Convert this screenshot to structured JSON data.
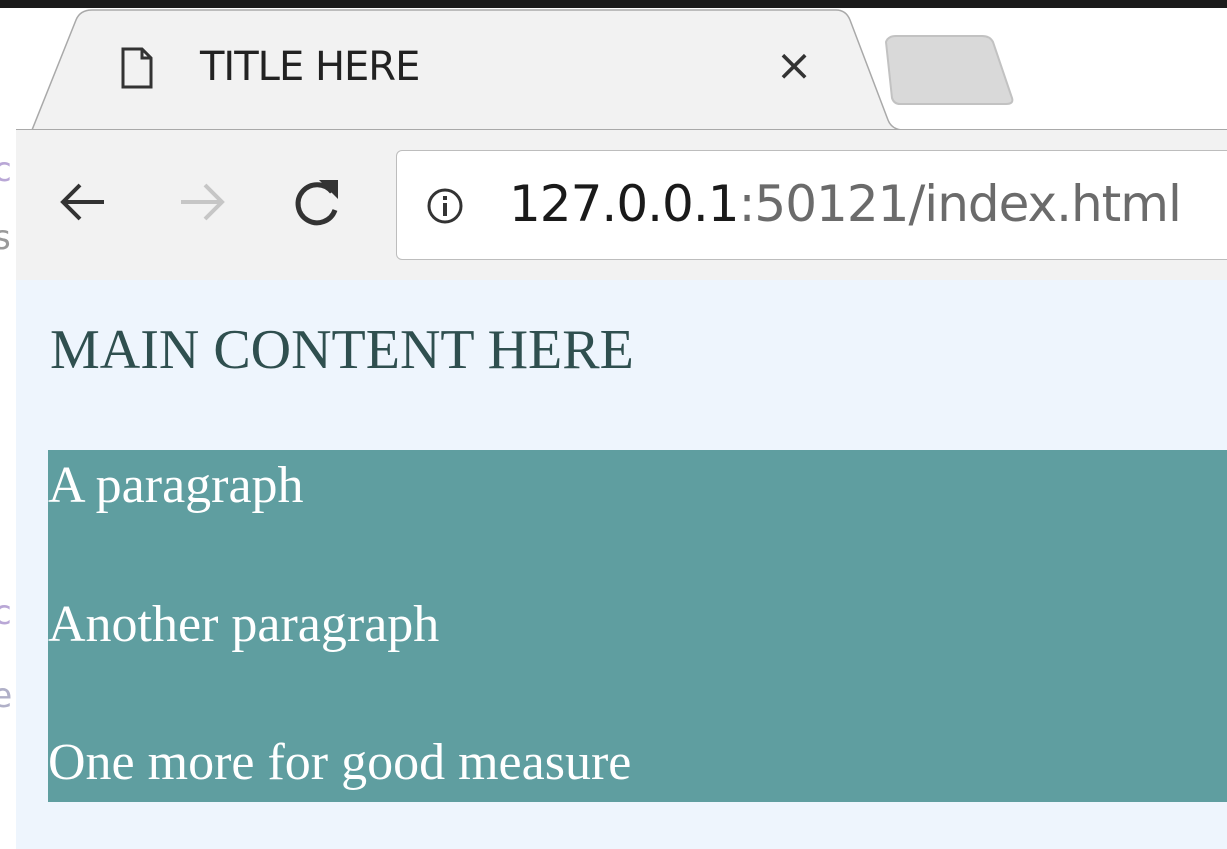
{
  "browser": {
    "tab": {
      "title": "TITLE HERE",
      "close_label": "×",
      "icon": "document-icon"
    },
    "toolbar": {
      "back_icon": "back-arrow-icon",
      "forward_icon": "forward-arrow-icon",
      "reload_icon": "reload-icon",
      "address": {
        "host": "127.0.0.1",
        "path": ":50121/index.html",
        "info_icon": "info-icon"
      }
    }
  },
  "page": {
    "heading": "MAIN CONTENT HERE",
    "paragraphs": [
      "A paragraph",
      "Another paragraph",
      "One more for good measure"
    ],
    "colors": {
      "background": "#eef5fd",
      "heading": "#2f4f4f",
      "block_bg": "#5f9ea0",
      "block_text": "#ffffff"
    }
  },
  "background_edge": {
    "glyphs": [
      "c",
      "s",
      "c",
      "e"
    ]
  }
}
